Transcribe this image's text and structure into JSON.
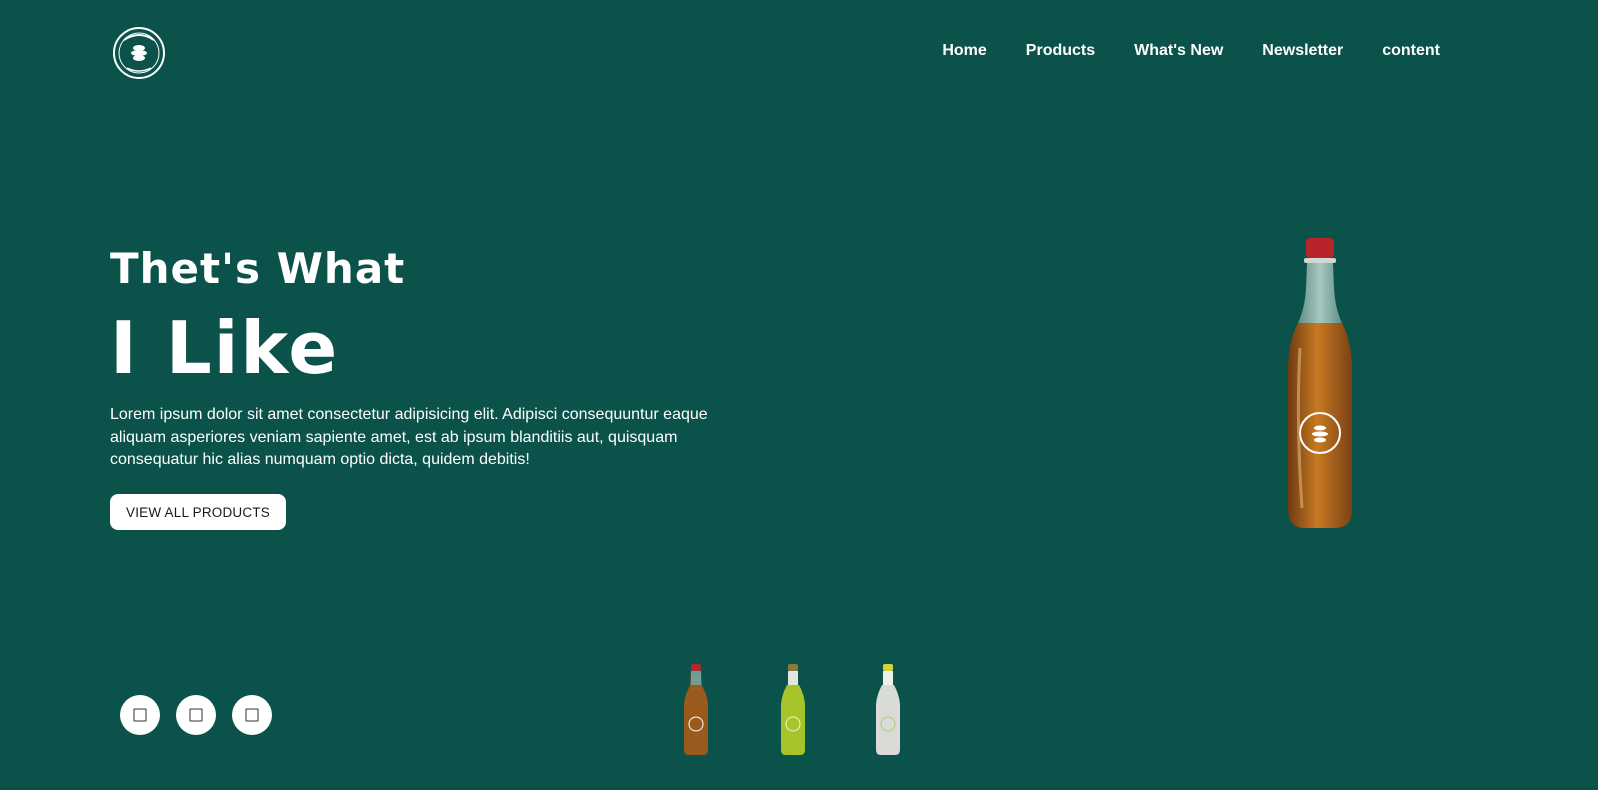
{
  "header": {
    "logo_icon": "brand-seal-icon",
    "nav": [
      {
        "label": "Home"
      },
      {
        "label": "Products"
      },
      {
        "label": "What's New"
      },
      {
        "label": "Newsletter"
      },
      {
        "label": "content"
      }
    ]
  },
  "hero": {
    "title_small": "Thet's What",
    "title_big": "I Like",
    "description": "Lorem ipsum dolor sit amet consectetur adipisicing elit. Adipisci consequuntur eaque aliquam asperiores veniam sapiente amet, est ab ipsum blanditiis aut, quisquam consequatur hic alias numquam optio dicta, quidem debitis!",
    "cta_label": "VIEW ALL PRODUCTS"
  },
  "socials": [
    {
      "icon": "facebook-icon"
    },
    {
      "icon": "twitter-icon"
    },
    {
      "icon": "instagram-icon"
    }
  ],
  "thumbnails": [
    {
      "name": "thumb-orange-bottle",
      "cap": "#b3262c",
      "liquid": "#9a5a1e"
    },
    {
      "name": "thumb-lime-bottle",
      "cap": "#8a7a3a",
      "liquid": "#a7c52b"
    },
    {
      "name": "thumb-clear-bottle",
      "cap": "#d8d23a",
      "liquid": "#d9dcd6"
    }
  ],
  "colors": {
    "background": "#0a524a",
    "text": "#ffffff",
    "button_bg": "#ffffff"
  }
}
